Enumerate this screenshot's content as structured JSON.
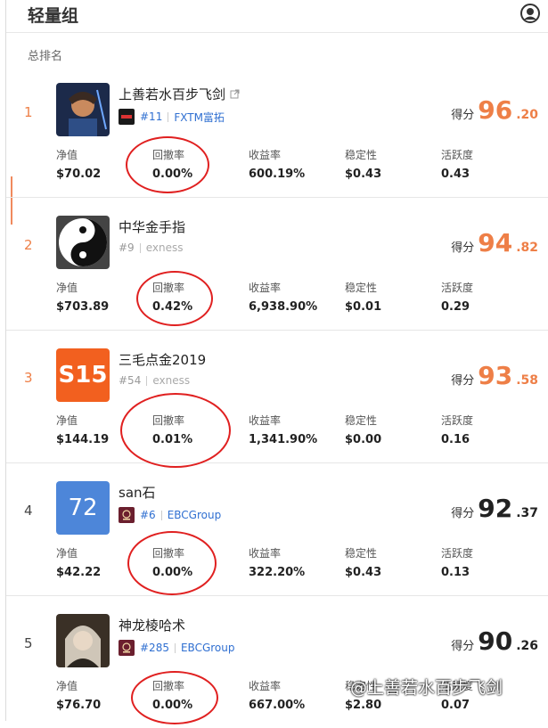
{
  "header": {
    "title": "轻量组",
    "user_icon": "user-circle-icon"
  },
  "section_label": "总排名",
  "metric_labels": {
    "nav": "净值",
    "drawdown": "回撤率",
    "return": "收益率",
    "stability": "稳定性",
    "activity": "活跃度"
  },
  "score_label": "得分",
  "rows": [
    {
      "rank": "1",
      "name": "上善若水百步飞剑",
      "number": "#11",
      "broker": "FXTM富拓",
      "score_int": "96",
      "score_dec": ".20",
      "nav": "$70.02",
      "drawdown": "0.00%",
      "return": "600.19%",
      "stability": "$0.43",
      "activity": "0.43"
    },
    {
      "rank": "2",
      "name": "中华金手指",
      "number": "#9",
      "broker": "exness",
      "score_int": "94",
      "score_dec": ".82",
      "nav": "$703.89",
      "drawdown": "0.42%",
      "return": "6,938.90%",
      "stability": "$0.01",
      "activity": "0.29"
    },
    {
      "rank": "3",
      "name": "三毛点金2019",
      "avatar_text": "S15",
      "number": "#54",
      "broker": "exness",
      "score_int": "93",
      "score_dec": ".58",
      "nav": "$144.19",
      "drawdown": "0.01%",
      "return": "1,341.90%",
      "stability": "$0.00",
      "activity": "0.16"
    },
    {
      "rank": "4",
      "name": "san石",
      "avatar_text": "72",
      "number": "#6",
      "broker": "EBCGroup",
      "score_int": "92",
      "score_dec": ".37",
      "nav": "$42.22",
      "drawdown": "0.00%",
      "return": "322.20%",
      "stability": "$0.43",
      "activity": "0.13"
    },
    {
      "rank": "5",
      "name": "神龙棱哈术",
      "number": "#285",
      "broker": "EBCGroup",
      "score_int": "90",
      "score_dec": ".26",
      "nav": "$76.70",
      "drawdown": "0.00%",
      "return": "667.00%",
      "stability": "$2.80",
      "activity": "0.07"
    }
  ],
  "watermark": "@上善若水百步飞剑",
  "colors": {
    "accent": "#ee7f47",
    "link": "#2f6fd1",
    "highlight_circle": "#e02020"
  }
}
